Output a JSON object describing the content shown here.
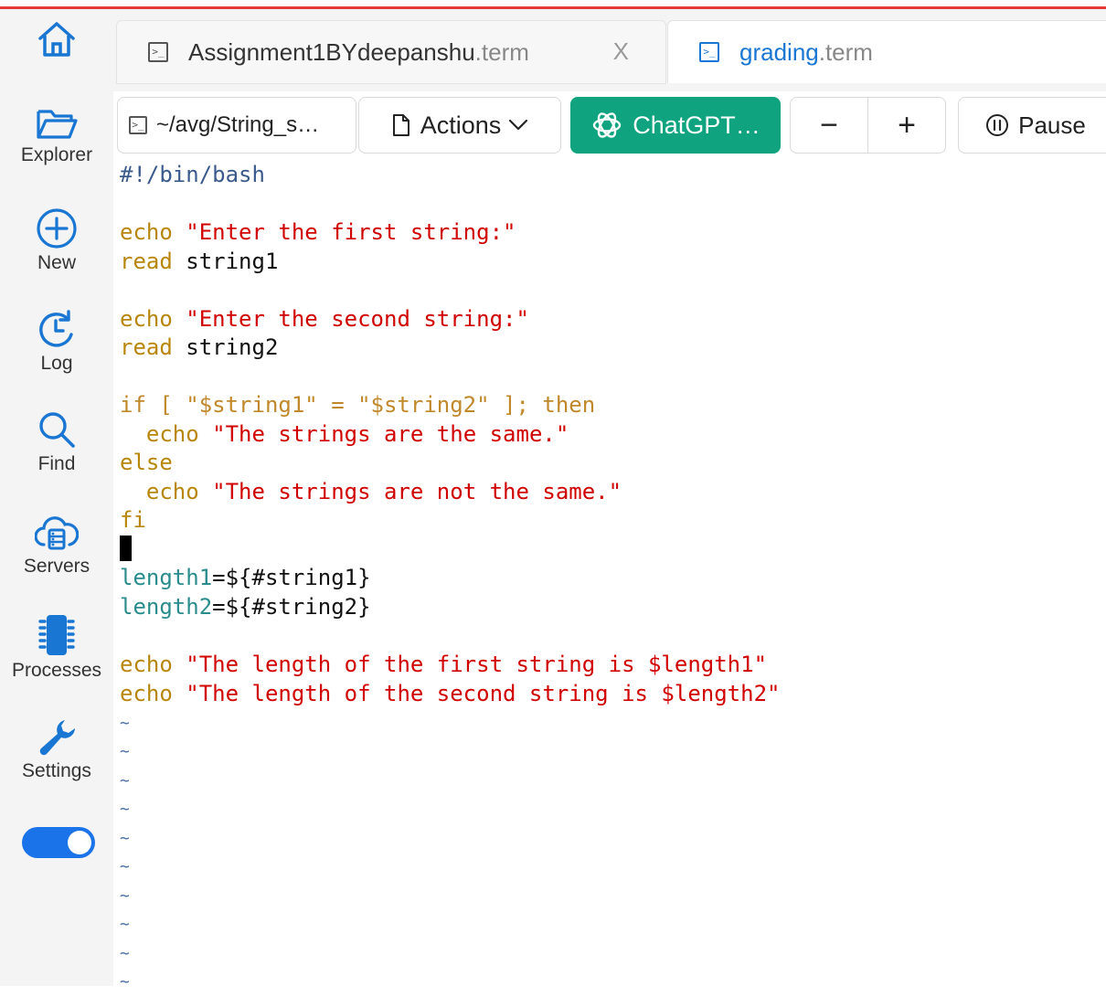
{
  "sidebar": {
    "items": [
      {
        "name": "home",
        "label": ""
      },
      {
        "name": "explorer",
        "label": "Explorer"
      },
      {
        "name": "new",
        "label": "New"
      },
      {
        "name": "log",
        "label": "Log"
      },
      {
        "name": "find",
        "label": "Find"
      },
      {
        "name": "servers",
        "label": "Servers"
      },
      {
        "name": "processes",
        "label": "Processes"
      },
      {
        "name": "settings",
        "label": "Settings"
      }
    ],
    "toggle_on": true
  },
  "tabs": [
    {
      "name": "Assignment1BYdeepanshu",
      "ext": ".term",
      "close": "X",
      "active": false
    },
    {
      "name": "grading",
      "ext": " .term",
      "active": true
    }
  ],
  "toolbar": {
    "path": "~/avg/String_s…",
    "actions": "Actions",
    "chatgpt": "ChatGPT…",
    "minus": "−",
    "plus": "+",
    "pause": "Pause"
  },
  "terminal": {
    "shebang": "#!/bin/bash",
    "l1_echo": "echo",
    "l1_str": "\"Enter the first string:\"",
    "l2_read": "read",
    "l2_var": "string1",
    "l3_echo": "echo",
    "l3_str": "\"Enter the second string:\"",
    "l4_read": "read",
    "l4_var": "string2",
    "if_line": "if [ \"$string1\" = \"$string2\" ]; then",
    "then_echo": "  echo",
    "then_str": "\"The strings are the same.\"",
    "else": "else",
    "else_echo": "  echo",
    "else_str": "\"The strings are not the same.\"",
    "fi": "fi",
    "len1_var": "length1",
    "len1_expr": "=${#string1}",
    "len2_var": "length2",
    "len2_expr": "=${#string2}",
    "out1_echo": "echo",
    "out1_str": "\"The length of the first string is $length1\"",
    "out2_echo": "echo",
    "out2_str": "\"The length of the second string is $length2\"",
    "tilde": "~"
  },
  "colors": {
    "accent": "#1976d2",
    "chatgpt": "#10a37f",
    "string": "#d00000",
    "keyword": "#b8860b",
    "variable": "#2a8c8c",
    "top_bar": "#e53935"
  }
}
